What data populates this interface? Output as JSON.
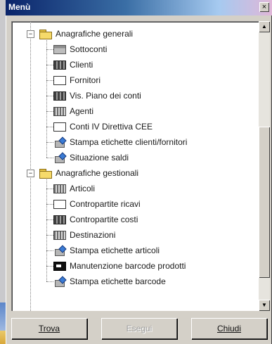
{
  "window": {
    "title": "Menù",
    "close_glyph": "×"
  },
  "tree": [
    {
      "level": 0,
      "expander": "−",
      "icon": "folder-icon",
      "label": "Anagrafiche generali"
    },
    {
      "level": 1,
      "icon": "gray-grid-icon",
      "label": "Sottoconti"
    },
    {
      "level": 1,
      "icon": "dark-grid-icon",
      "label": "Clienti"
    },
    {
      "level": 1,
      "icon": "empty-box-icon",
      "label": "Fornitori"
    },
    {
      "level": 1,
      "icon": "dark-grid-icon",
      "label": "Vis. Piano dei conti"
    },
    {
      "level": 1,
      "icon": "striped-grid-icon",
      "label": "Agenti"
    },
    {
      "level": 1,
      "icon": "empty-box-icon",
      "label": "Conti IV Direttiva CEE"
    },
    {
      "level": 1,
      "icon": "printer-icon",
      "label": "Stampa etichette clienti/fornitori"
    },
    {
      "level": 1,
      "icon": "printer-icon",
      "label": "Situazione saldi"
    },
    {
      "level": 0,
      "expander": "−",
      "icon": "folder-icon",
      "label": "Anagrafiche gestionali"
    },
    {
      "level": 1,
      "icon": "striped-grid-icon",
      "label": "Articoli"
    },
    {
      "level": 1,
      "icon": "empty-box-icon",
      "label": "Contropartite ricavi"
    },
    {
      "level": 1,
      "icon": "dark-grid-icon",
      "label": "Contropartite costi"
    },
    {
      "level": 1,
      "icon": "striped-grid-icon",
      "label": "Destinazioni"
    },
    {
      "level": 1,
      "icon": "printer-icon",
      "label": "Stampa etichette articoli"
    },
    {
      "level": 1,
      "icon": "black-box-icon",
      "label": "Manutenzione barcode prodotti"
    },
    {
      "level": 1,
      "icon": "printer-icon",
      "label": "Stampa etichette barcode"
    }
  ],
  "scroll": {
    "up_glyph": "▲",
    "down_glyph": "▼"
  },
  "buttons": {
    "trova": "Trova",
    "esegui": "Esegui",
    "chiudi": "Chiudi"
  }
}
